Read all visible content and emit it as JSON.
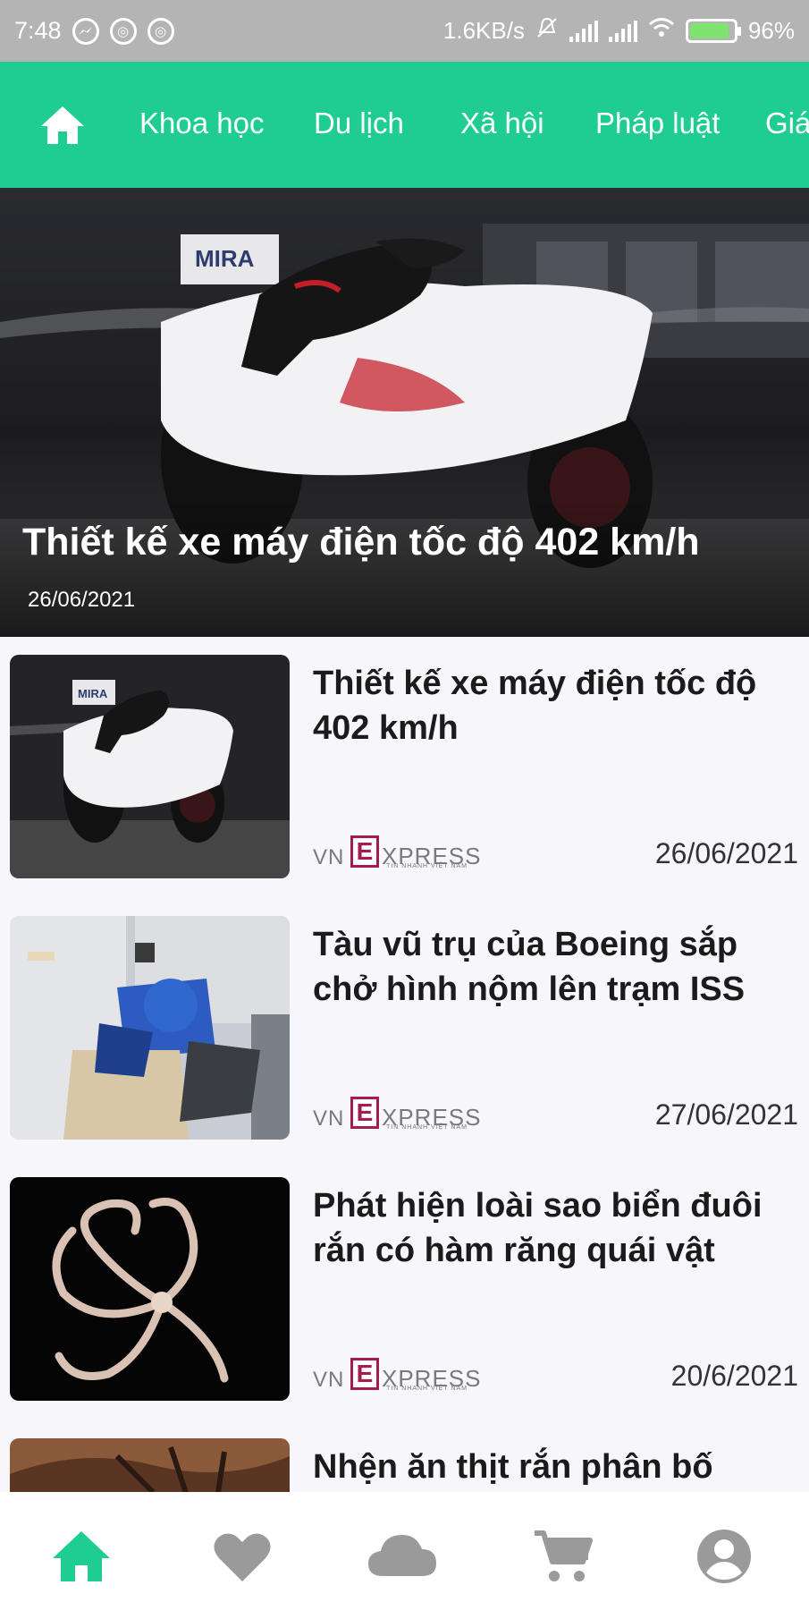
{
  "status_bar": {
    "time": "7:48",
    "network_speed": "1.6KB/s",
    "battery": "96%",
    "icons": [
      "messenger-icon",
      "notification-icon",
      "notification-icon",
      "mute-icon",
      "signal-icon",
      "signal-icon",
      "wifi-icon",
      "battery-icon"
    ]
  },
  "top_nav": {
    "home_icon": "home-icon",
    "tabs": [
      "Khoa học",
      "Du lịch",
      "Xã hội",
      "Pháp luật",
      "Giá"
    ]
  },
  "hero": {
    "title": "Thiết kế xe máy điện tốc độ 402 km/h",
    "date": "26/06/2021",
    "image_sign": "MIRA"
  },
  "news": [
    {
      "title": "Thiết kế xe máy điện tốc độ 402 km/h",
      "date": "26/06/2021",
      "image_sign": "MIRA"
    },
    {
      "title": "Tàu vũ trụ của Boeing sắp chở hình nộm lên trạm ISS",
      "date": "27/06/2021"
    },
    {
      "title": "Phát hiện loài sao biển đuôi rắn có hàm răng quái vật",
      "date": "20/6/2021"
    },
    {
      "title": "Nhện ăn thịt rắn phân bố"
    }
  ],
  "source_logo": {
    "vn": "VN",
    "e": "E",
    "xpress": "XPRESS",
    "tagline": "TIN NHANH VIỆT NAM"
  },
  "bottom_nav": {
    "items": [
      "home-icon",
      "heart-icon",
      "cloud-icon",
      "cart-icon",
      "account-icon"
    ],
    "active_color": "#1fcd92",
    "inactive_color": "#9a9a9a"
  },
  "colors": {
    "accent": "#1fcd92",
    "status_bar": "#b4b4b4",
    "logo": "#a31d4e"
  }
}
